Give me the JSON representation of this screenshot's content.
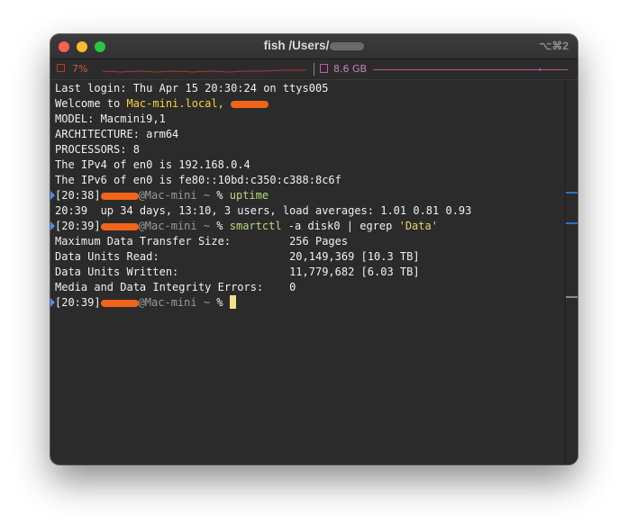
{
  "window": {
    "title_prefix": "fish /Users/",
    "shortcut": "⌥⌘2"
  },
  "status": {
    "cpu_label": "7%",
    "memory_label": "8.6 GB"
  },
  "terminal": {
    "lines": {
      "l0": "Last login: Thu Apr 15 20:30:24 on ttys005",
      "l1a": "Welcome to ",
      "l1b": "Mac-mini.local,",
      "l2": "MODEL: Macmini9,1",
      "l3": "ARCHITECTURE: arm64",
      "l4": "PROCESSORS: 8",
      "l5": "The IPv4 of en0 is 192.168.0.4",
      "l6": "The IPv6 of en0 is fe80::10bd:c350:c388:8c6f",
      "p1_time": "[20:38]",
      "p1_host": "@Mac-mini",
      "p1_path": " ~ ",
      "p1_sym": "% ",
      "p1_cmd": "uptime",
      "l8": "20:39  up 34 days, 13:10, 3 users, load averages: 1.01 0.81 0.93",
      "p2_time": "[20:39]",
      "p2_host": "@Mac-mini",
      "p2_path": " ~ ",
      "p2_sym": "% ",
      "p2_cmd": "smartctl",
      "p2_args": " -a disk0 | egrep ",
      "p2_str": "'Data'",
      "l10": "Maximum Data Transfer Size:         256 Pages",
      "l11": "Data Units Read:                    20,149,369 [10.3 TB]",
      "l12": "Data Units Written:                 11,779,682 [6.03 TB]",
      "l13": "Media and Data Integrity Errors:    0",
      "p3_time": "[20:39]",
      "p3_host": "@Mac-mini",
      "p3_path": " ~ ",
      "p3_sym": "% "
    }
  },
  "colors": {
    "accent_yellow": "#fcd535",
    "redaction_orange": "#f2641a",
    "cpu_red": "#d55a4a",
    "mem_pink": "#c783b8",
    "scroll_mark_blue": "#2f6fd0"
  }
}
